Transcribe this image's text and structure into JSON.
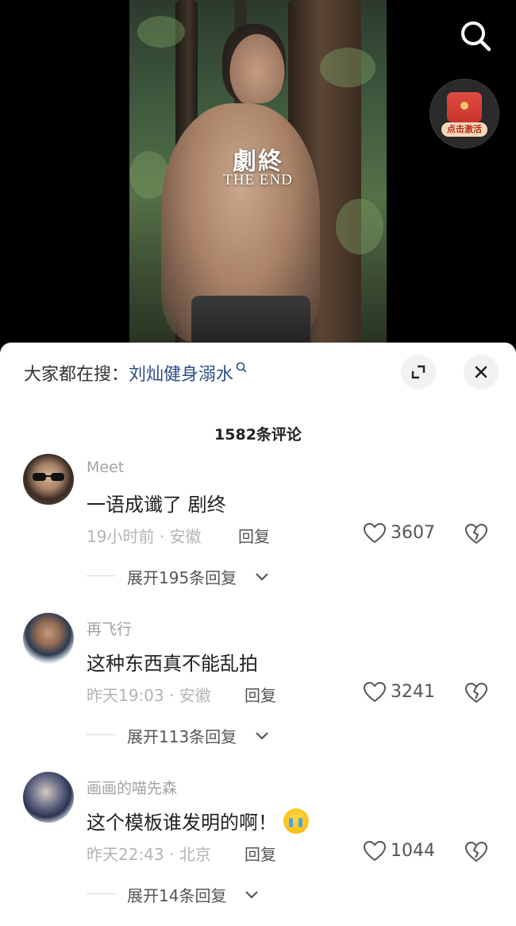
{
  "video": {
    "overlay_title": "劇終",
    "overlay_subtitle": "THE END",
    "hongbao_button": "点击激活"
  },
  "panel": {
    "trend_prefix": "大家都在搜：",
    "trend_term": "刘灿健身溺水",
    "comment_count": "1582条评论"
  },
  "comments": [
    {
      "username": "Meet",
      "text": "一语成谶了 剧终",
      "time_location": "19小时前 · 安徽",
      "reply_label": "回复",
      "likes": "3607",
      "expand_label": "展开195条回复"
    },
    {
      "username": "再飞行",
      "text": "这种东西真不能乱拍",
      "time_location": "昨天19:03 · 安徽",
      "reply_label": "回复",
      "likes": "3241",
      "expand_label": "展开113条回复"
    },
    {
      "username": "画画的喵先森",
      "text": "这个模板谁发明的啊！",
      "time_location": "昨天22:43 · 北京",
      "reply_label": "回复",
      "likes": "1044",
      "expand_label": "展开14条回复"
    }
  ],
  "icons": {
    "search": "search-icon",
    "expand": "expand-icon",
    "close": "close-icon",
    "like": "heart-icon",
    "dislike": "broken-heart-icon",
    "chevron": "chevron-down-icon",
    "emoji": "crying-emoji-icon"
  },
  "colors": {
    "trend_term": "#2b4e89",
    "panel_bg": "#ffffff",
    "muted_text": "#b4b4b4",
    "hongbao_red": "#d33b32"
  }
}
